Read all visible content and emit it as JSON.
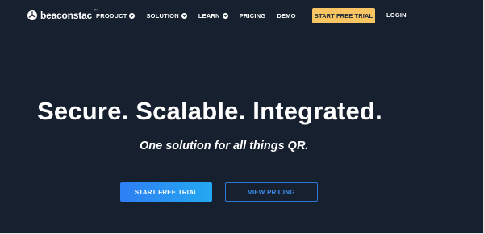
{
  "header": {
    "logo_text": "beaconstac",
    "logo_tm": "™",
    "nav": [
      {
        "label": "PRODUCT",
        "has_dropdown": true,
        "icon": "chevron-down-icon"
      },
      {
        "label": "SOLUTION",
        "has_dropdown": true,
        "icon": "chevron-down-icon"
      },
      {
        "label": "LEARN",
        "has_dropdown": true,
        "icon": "chevron-down-icon"
      },
      {
        "label": "PRICING",
        "has_dropdown": false
      },
      {
        "label": "DEMO",
        "has_dropdown": false
      }
    ],
    "trial_button": "START FREE TRIAL",
    "login": "LOGIN"
  },
  "hero": {
    "headline": "Secure. Scalable. Integrated.",
    "tagline": "One solution for all things QR.",
    "primary_cta": "START FREE TRIAL",
    "secondary_cta": "VIEW PRICING"
  },
  "colors": {
    "background": "#16202f",
    "accent_yellow": "#f9c563",
    "accent_blue": "#2f7ff5",
    "outline_blue": "#2c78d6"
  }
}
